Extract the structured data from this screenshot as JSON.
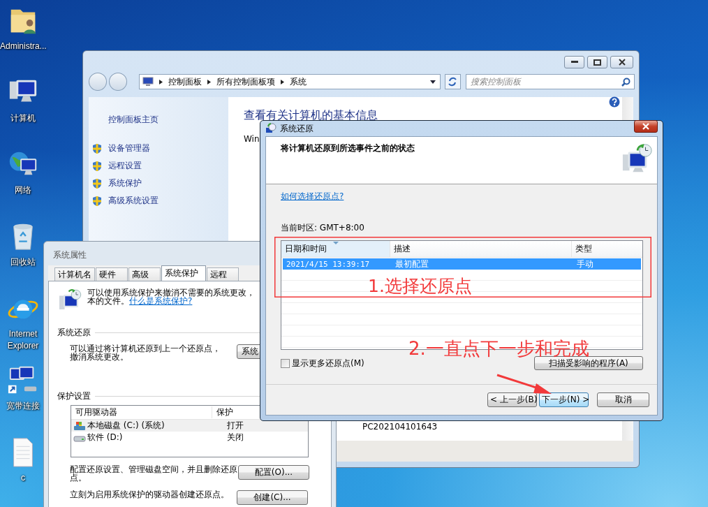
{
  "desktop_icons": [
    {
      "label": "Administra...",
      "kind": "user-folder"
    },
    {
      "label": "计算机",
      "kind": "computer"
    },
    {
      "label": "网络",
      "kind": "network"
    },
    {
      "label": "回收站",
      "kind": "recycle-bin"
    },
    {
      "label": "Internet Explorer",
      "kind": "browser"
    },
    {
      "label": "宽带连接",
      "kind": "connection"
    },
    {
      "label": "c",
      "kind": "document"
    }
  ],
  "control_panel": {
    "breadcrumb": [
      "控制面板",
      "所有控制面板项",
      "系统"
    ],
    "search": {
      "placeholder": "搜索控制面板"
    },
    "home_link": "控制面板主页",
    "tasks": [
      "设备管理器",
      "远程设置",
      "系统保护",
      "高级系统设置"
    ],
    "heading": "查看有关计算机的基本信息",
    "edition_fragment": "Win",
    "computer_name": "PC202104101643"
  },
  "system_properties": {
    "title": "系统属性",
    "tabs": [
      {
        "label": "计算机名",
        "selected": false
      },
      {
        "label": "硬件",
        "selected": false
      },
      {
        "label": "高级",
        "selected": false
      },
      {
        "label": "系统保护",
        "selected": true
      },
      {
        "label": "远程",
        "selected": false
      }
    ],
    "intro": "可以使用系统保护来撤消不需要的系统更改，",
    "intro_line2": "本的文件。",
    "intro_link": "什么是系统保护?",
    "restore_group": "系统还原",
    "restore_text": "可以通过将计算机还原到上一个还原点，撤消系统更改。",
    "restore_button": "系统",
    "protection_group": "保护设置",
    "drives": {
      "columns": [
        "可用驱动器",
        "保护"
      ],
      "rows": [
        {
          "name": "本地磁盘 (C:) (系统)",
          "protection": "打开",
          "kind": "system",
          "selected": true
        },
        {
          "name": "软件 (D:)",
          "protection": "关闭",
          "kind": "disk",
          "selected": false
        }
      ]
    },
    "configure_text": "配置还原设置、管理磁盘空间，并且删除还原点。",
    "configure_button": "配置(O)...",
    "create_text": "立刻为启用系统保护的驱动器创建还原点。",
    "create_button": "创建(C)..."
  },
  "restore_dialog": {
    "title": "系统还原",
    "heading": "将计算机还原到所选事件之前的状态",
    "help_link": "如何选择还原点?",
    "time_zone": "当前时区: GMT+8:00",
    "table": {
      "columns": [
        "日期和时间",
        "描述",
        "类型"
      ],
      "rows": [
        {
          "date": "2021/4/15 13:39:17",
          "description": "最初配置",
          "type": "手动",
          "selected": true
        }
      ]
    },
    "show_more": {
      "label": "显示更多还原点(M)",
      "checked": false
    },
    "scan_button": "扫描受影响的程序(A)",
    "buttons": [
      {
        "label": "< 上一步(B)",
        "focused": false
      },
      {
        "label": "下一步(N) >",
        "focused": true
      },
      {
        "label": "取消",
        "focused": false
      }
    ]
  },
  "annotations": {
    "step_1": "1.选择还原点",
    "step_2": "2.一直点下一步和完成"
  }
}
